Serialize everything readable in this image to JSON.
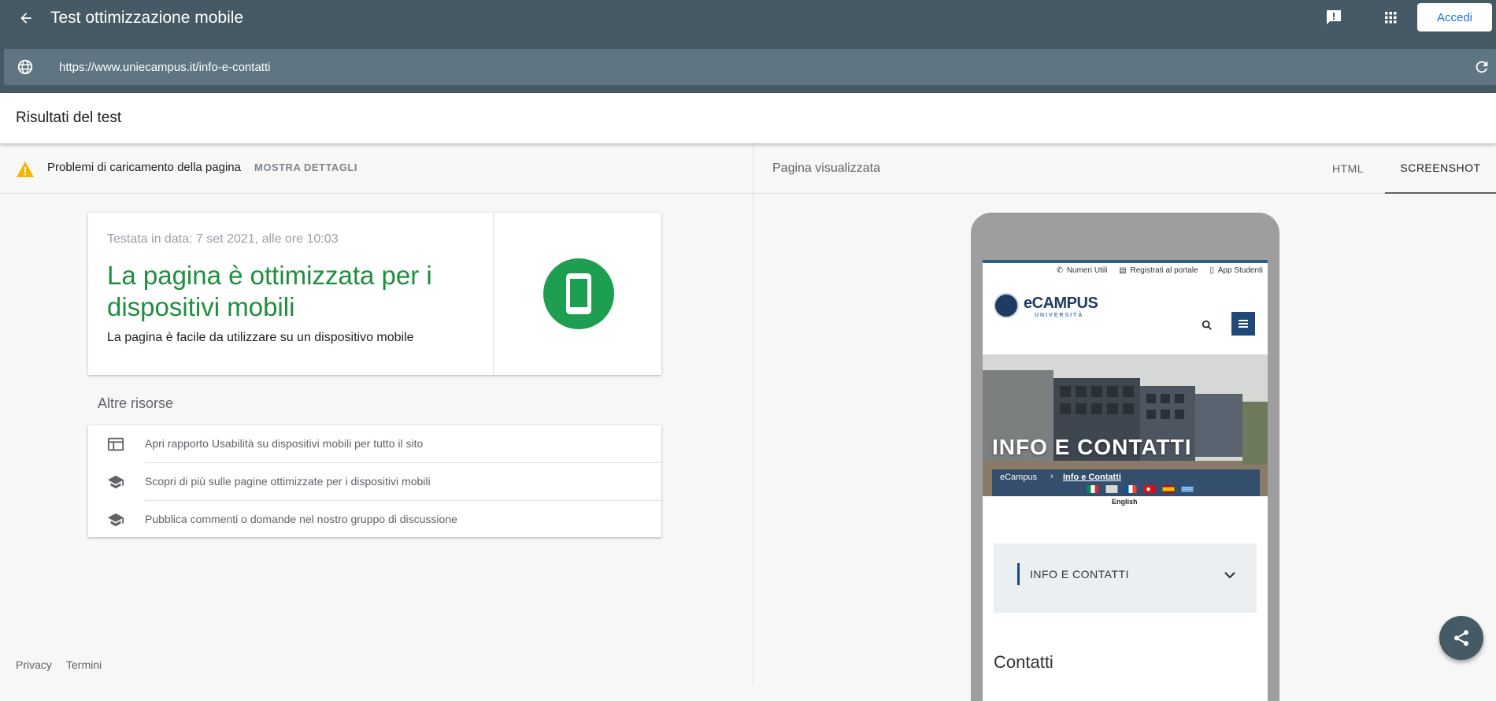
{
  "header": {
    "title": "Test ottimizzazione mobile",
    "login_label": "Accedi",
    "url_value": "https://www.uniecampus.it/info-e-contatti"
  },
  "results": {
    "title": "Risultati del test"
  },
  "issues": {
    "text": "Problemi di caricamento della pagina",
    "details_label": "MOSTRA DETTAGLI"
  },
  "result_card": {
    "tested_date": "Testata in data: 7 set 2021, alle ore 10:03",
    "verdict": "La pagina è ottimizzata per i dispositivi mobili",
    "subtitle": "La pagina è facile da utilizzare su un dispositivo mobile"
  },
  "resources": {
    "title": "Altre risorse",
    "items": [
      {
        "label": "Apri rapporto Usabilità su dispositivi mobili per tutto il sito",
        "icon": "web-report-icon"
      },
      {
        "label": "Scopri di più sulle pagine ottimizzate per i dispositivi mobili",
        "icon": "school-icon"
      },
      {
        "label": "Pubblica commenti o domande nel nostro gruppo di discussione",
        "icon": "school-icon"
      }
    ]
  },
  "footer": {
    "privacy": "Privacy",
    "terms": "Termini"
  },
  "preview": {
    "title": "Pagina visualizzata",
    "tabs": [
      {
        "label": "HTML",
        "active": false
      },
      {
        "label": "SCREENSHOT",
        "active": true
      }
    ]
  },
  "phone_site": {
    "top_links": [
      "Numeri Utili",
      "Registrati al portale",
      "App Studenti"
    ],
    "logo_text": "eCAMPUS",
    "logo_sub": "UNIVERSITÀ",
    "hero_title": "INFO E CONTATTI",
    "breadcrumb_home": "eCampus",
    "breadcrumb_current": "Info e Contatti",
    "lang_label": "English",
    "accordion_label": "INFO E CONTATTI",
    "contacts_title": "Contatti"
  },
  "colors": {
    "header_bg": "#455a64",
    "urlbar_bg": "#5f7682",
    "success_green": "#1e8e3e",
    "warning_yellow": "#f4b400",
    "link_blue": "#1a73e8",
    "ecampus_blue": "#1f4a78"
  }
}
